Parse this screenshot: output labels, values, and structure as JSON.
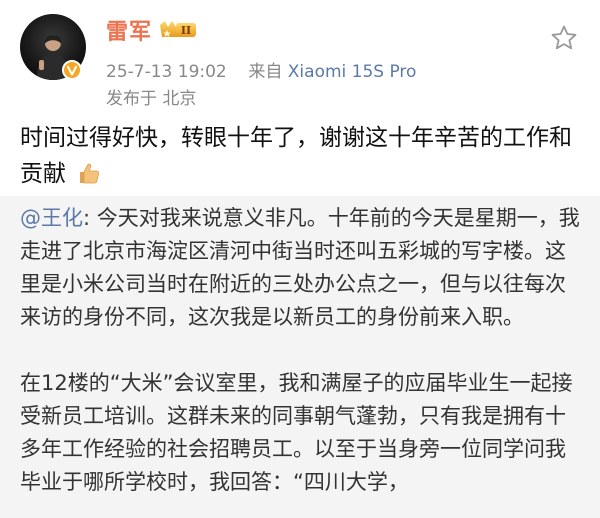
{
  "user": {
    "name": "雷军",
    "level_badge": "II",
    "timestamp": "25-7-13 19:02",
    "source_prefix": "来自",
    "source": "Xiaomi 15S Pro",
    "location": "发布于 北京"
  },
  "post": {
    "text": "时间过得好快，转眼十年了，谢谢这十年辛苦的工作和贡献"
  },
  "quote": {
    "mention": "@王化",
    "paragraph1_rest": ": 今天对我来说意义非凡。十年前的今天是星期一，我走进了北京市海淀区清河中街当时还叫五彩城的写字楼。这里是小米公司当时在附近的三处办公点之一，但与以往每次来访的身份不同，这次我是以新员工的身份前来入职。",
    "paragraph2": "在12楼的“大米”会议室里，我和满屋子的应届毕业生一起接受新员工培训。这群未来的同事朝气蓬勃，只有我是拥有十多年工作经验的社会招聘员工。以至于当身旁一位同学问我毕业于哪所学校时，我回答：“四川大学，"
  },
  "colors": {
    "username": "#eb7350",
    "link": "#5b7aa8",
    "quote_bg": "#f4f4f4"
  },
  "icons": {
    "favorite": "star-outline-icon",
    "verified": "verified-badge-icon",
    "thumbs_up": "thumbs-up-emoji"
  }
}
